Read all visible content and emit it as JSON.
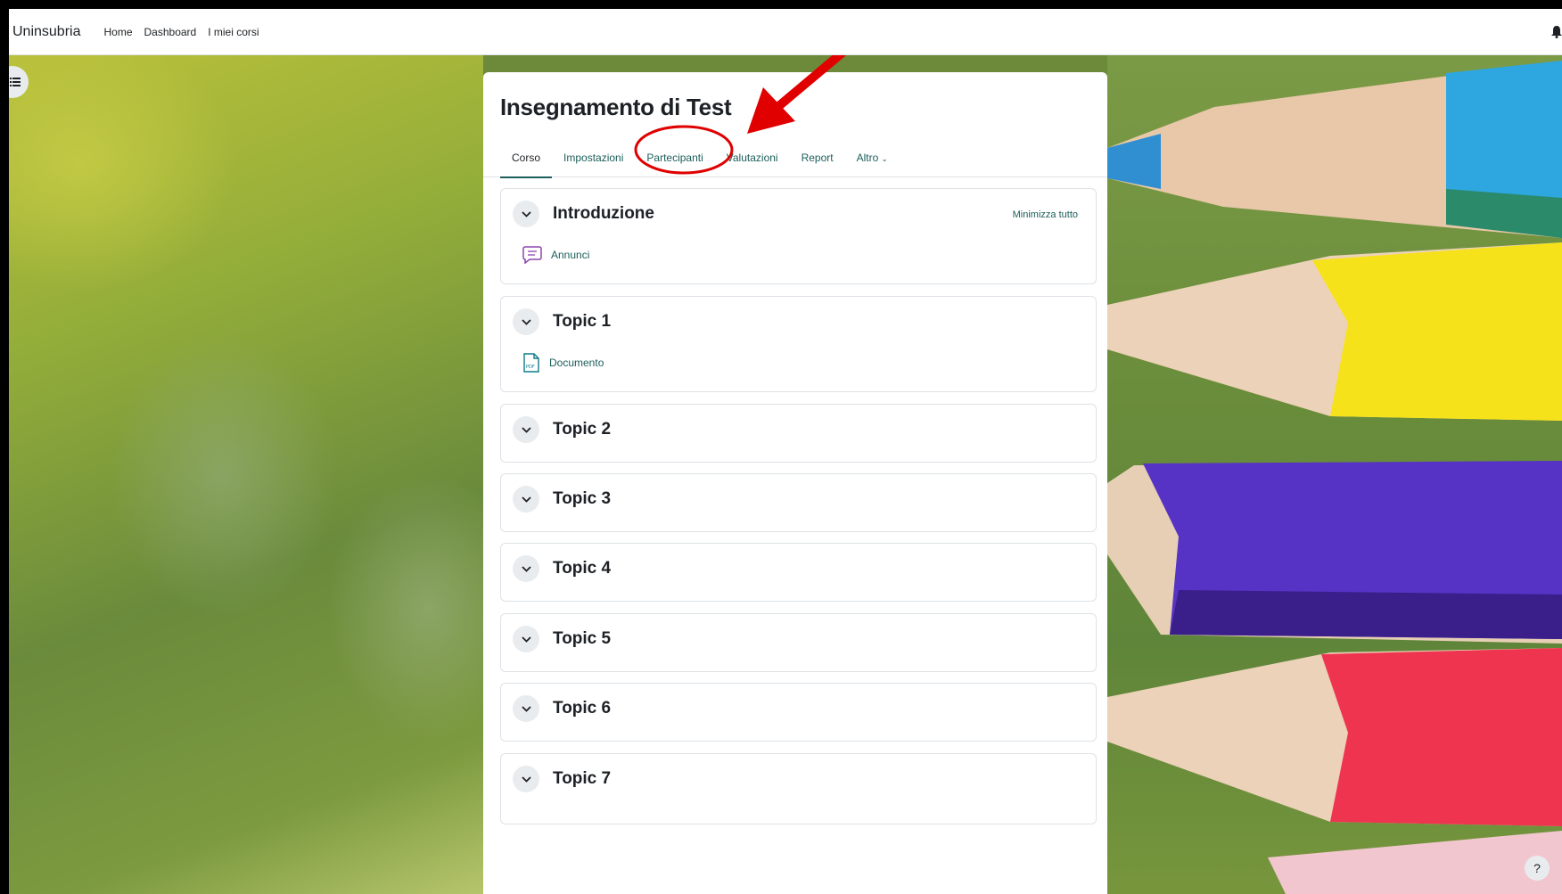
{
  "navbar": {
    "brand": "Uninsubria",
    "links": [
      "Home",
      "Dashboard",
      "I miei corsi"
    ]
  },
  "course": {
    "title": "Insegnamento di Test",
    "tabs": [
      {
        "label": "Corso",
        "active": true
      },
      {
        "label": "Impostazioni",
        "active": false
      },
      {
        "label": "Partecipanti",
        "active": false
      },
      {
        "label": "Valutazioni",
        "active": false
      },
      {
        "label": "Report",
        "active": false
      },
      {
        "label": "Altro",
        "active": false
      }
    ],
    "collapse_all": "Minimizza tutto",
    "sections": [
      {
        "title": "Introduzione",
        "activities": [
          {
            "label": "Annunci",
            "icon": "forum-icon"
          }
        ]
      },
      {
        "title": "Topic 1",
        "activities": [
          {
            "label": "Documento",
            "icon": "pdf-file-icon"
          }
        ]
      },
      {
        "title": "Topic 2",
        "activities": []
      },
      {
        "title": "Topic 3",
        "activities": []
      },
      {
        "title": "Topic 4",
        "activities": []
      },
      {
        "title": "Topic 5",
        "activities": []
      },
      {
        "title": "Topic 6",
        "activities": []
      },
      {
        "title": "Topic 7",
        "activities": []
      }
    ]
  },
  "help": {
    "label": "?"
  },
  "colors": {
    "accent": "#1b5e5a",
    "forum_icon": "#8e44ad",
    "pdf_icon": "#0f7c8a",
    "annotation": "#e00000"
  }
}
